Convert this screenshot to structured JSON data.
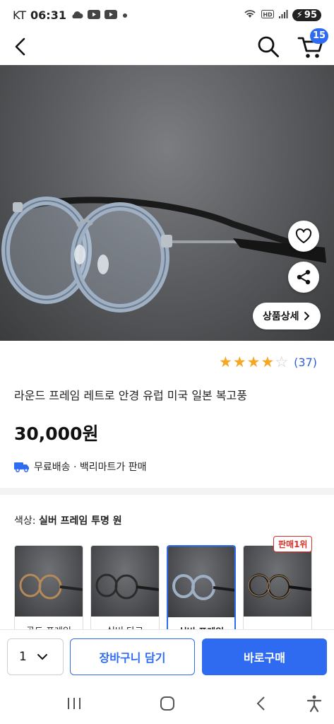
{
  "status_bar": {
    "carrier": "KT",
    "time": "06:31",
    "battery": "95"
  },
  "header": {
    "cart_count": "15"
  },
  "product": {
    "detail_button_label": "상품상세",
    "rating": 4,
    "review_count": "(37)",
    "title": "라운드 프레임 레트로 안경 유럽 미국 일본 복고풍",
    "price": "30,000원",
    "shipping": "무료배송 · 백리마트가 판매"
  },
  "options": {
    "label_prefix": "색상: ",
    "label_value": "실버 프레임 투명 원",
    "best_badge": "판매1위",
    "items": [
      {
        "name": "골드 프레임",
        "frame_color": "#b58a5a"
      },
      {
        "name": "실버 다크",
        "frame_color": "#3a3a3a"
      },
      {
        "name": "실버 프레임",
        "frame_color": "#9fb0c4"
      },
      {
        "name": "",
        "frame_color": "#2a2a2a"
      }
    ]
  },
  "purchase_bar": {
    "quantity": "1",
    "add_to_cart_label": "장바구니 담기",
    "buy_now_label": "바로구매"
  },
  "colors": {
    "accent": "#2f6bf0",
    "star": "#f5a623",
    "badge_red": "#d93025"
  }
}
